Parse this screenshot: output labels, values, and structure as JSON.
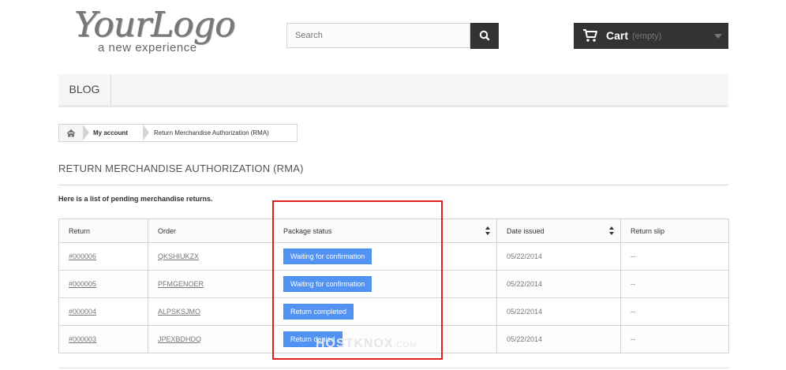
{
  "logo": {
    "main": "YourLogo",
    "tagline": "a new experience"
  },
  "search": {
    "placeholder": "Search"
  },
  "cart": {
    "title": "Cart",
    "status": "(empty)"
  },
  "nav": {
    "items": [
      {
        "label": "BLOG"
      }
    ]
  },
  "breadcrumb": {
    "parent": "My account",
    "current": "Return Merchandise Authorization (RMA)"
  },
  "page": {
    "title": "RETURN MERCHANDISE AUTHORIZATION (RMA)",
    "intro": "Here is a list of pending merchandise returns."
  },
  "table": {
    "headers": [
      "Return",
      "Order",
      "Package status",
      "Date issued",
      "Return slip"
    ],
    "rows": [
      {
        "return": "#000006",
        "order": "QKSHIUKZX",
        "status": "Waiting for confirmation",
        "date": "05/22/2014",
        "slip": "--"
      },
      {
        "return": "#000005",
        "order": "PFMGENOER",
        "status": "Waiting for confirmation",
        "date": "05/22/2014",
        "slip": "--"
      },
      {
        "return": "#000004",
        "order": "ALPSKSJMO",
        "status": "Return completed",
        "date": "05/22/2014",
        "slip": "--"
      },
      {
        "return": "#000003",
        "order": "JPEXBDHDQ",
        "status": "Return denied",
        "date": "05/22/2014",
        "slip": "--"
      }
    ]
  },
  "watermark": {
    "text": "HOSTKNOX",
    "suffix": ".COM"
  },
  "colors": {
    "status_badge": "#5192f3",
    "highlight": "#e02020",
    "dark": "#333333"
  }
}
